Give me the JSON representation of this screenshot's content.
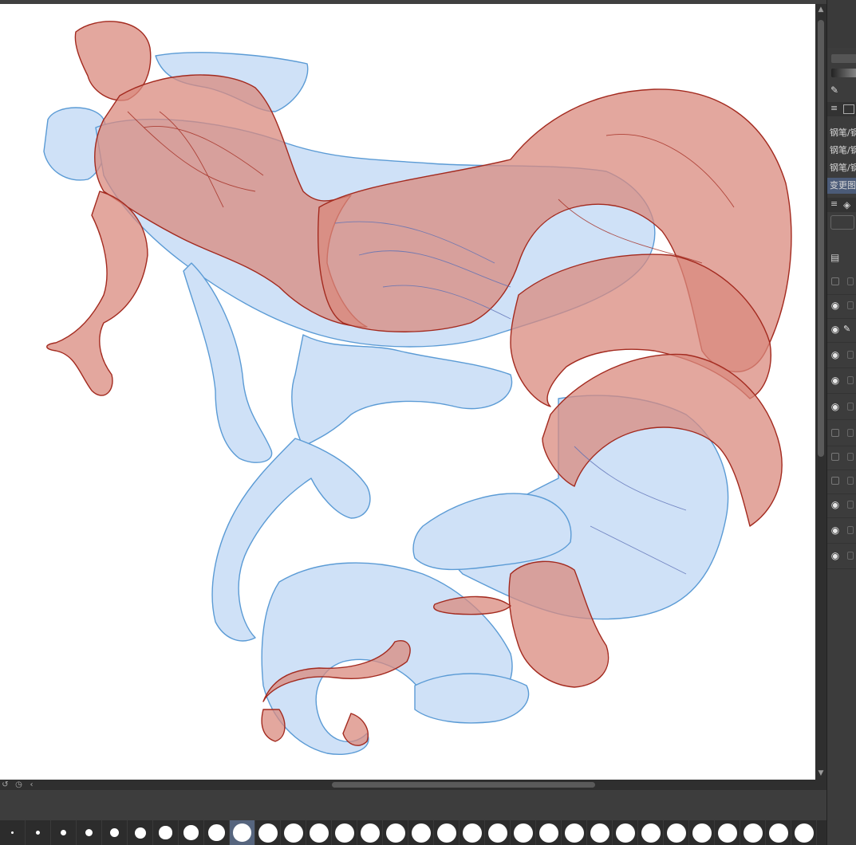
{
  "app": {
    "accent_color": "#56657e",
    "sketch_red": "#c0392b",
    "sketch_blue": "#5b9bd5"
  },
  "right_panel": {
    "tool_rows": [
      {
        "label": "钢笔/钢"
      },
      {
        "label": "钢笔/钢"
      },
      {
        "label": "钢笔/钢"
      },
      {
        "label": "变更图"
      }
    ],
    "selected_tool_index": 3,
    "layers": [
      {
        "visible": false,
        "editing": false
      },
      {
        "visible": true,
        "editing": false
      },
      {
        "visible": true,
        "editing": true
      },
      {
        "visible": true,
        "editing": false
      },
      {
        "visible": true,
        "editing": false
      },
      {
        "visible": true,
        "editing": false
      },
      {
        "visible": false,
        "editing": false
      },
      {
        "visible": false,
        "editing": false
      },
      {
        "visible": false,
        "editing": false
      },
      {
        "visible": true,
        "editing": false
      },
      {
        "visible": true,
        "editing": false
      },
      {
        "visible": true,
        "editing": false
      }
    ],
    "icons": [
      "pipette-icon",
      "menu-icon",
      "layers-icon",
      "layer-settings-icon"
    ]
  },
  "brush_bar": {
    "sizes": [
      1,
      2,
      3,
      4,
      5,
      6,
      7,
      8,
      9,
      10,
      11,
      12,
      13,
      14,
      15,
      16,
      17,
      18,
      19,
      20,
      21,
      22,
      23,
      24,
      25,
      26,
      27,
      28,
      29,
      30,
      31,
      32
    ],
    "selected_index": 9
  },
  "scrollbars": {
    "horizontal_icons": [
      "rotate-icon",
      "timer-icon",
      "chevron-left-icon"
    ]
  }
}
